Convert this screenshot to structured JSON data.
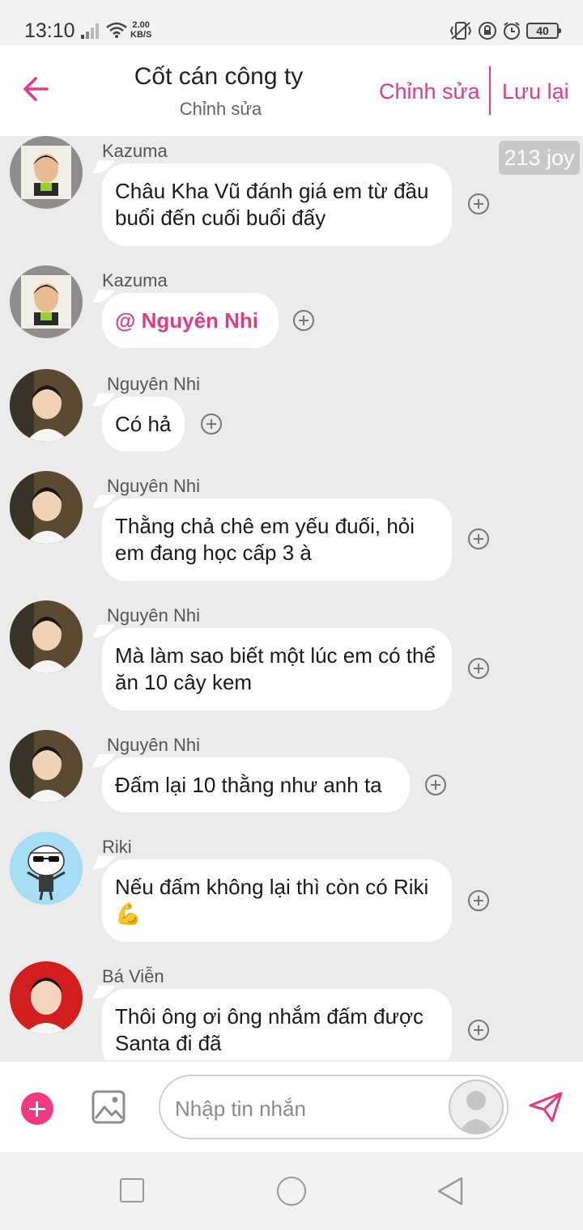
{
  "status_bar": {
    "time": "13:10",
    "net_speed_value": "2.00",
    "net_speed_unit": "KB/S",
    "battery": "40",
    "icons": [
      "signal-icon",
      "wifi-icon",
      "vibrate-icon",
      "lock-rotation-icon",
      "alarm-icon",
      "battery-icon"
    ]
  },
  "header": {
    "title": "Cốt cán công ty",
    "subtitle": "Chỉnh sửa",
    "edit_label": "Chỉnh sửa",
    "save_label": "Lưu lại",
    "accent_color": "#e23b86"
  },
  "joy_badge": "213 joy",
  "messages": [
    {
      "sender": "Kazuma",
      "text": "Châu Kha Vũ đánh giá em từ đầu buổi đến cuối buổi đấy"
    },
    {
      "sender": "Kazuma",
      "text": "@ Nguyên Nhi",
      "mention": true
    },
    {
      "sender": "Nguyên Nhi",
      "text": "Có hả"
    },
    {
      "sender": "Nguyên Nhi",
      "text": "Thằng chả chê em yếu đuối, hỏi em đang học cấp 3 à"
    },
    {
      "sender": "Nguyên Nhi",
      "text": "Mà làm sao biết một lúc em có thể ăn 10 cây kem"
    },
    {
      "sender": "Nguyên Nhi",
      "text": "Đấm lại 10 thằng như anh ta"
    },
    {
      "sender": "Riki",
      "text": "Nếu đấm không lại thì còn có Riki 💪"
    },
    {
      "sender": "Bá Viễn",
      "text": "Thôi ông ơi ông nhắm đấm được Santa đi đã"
    }
  ],
  "input": {
    "placeholder": "Nhập tin nhắn",
    "value": ""
  }
}
